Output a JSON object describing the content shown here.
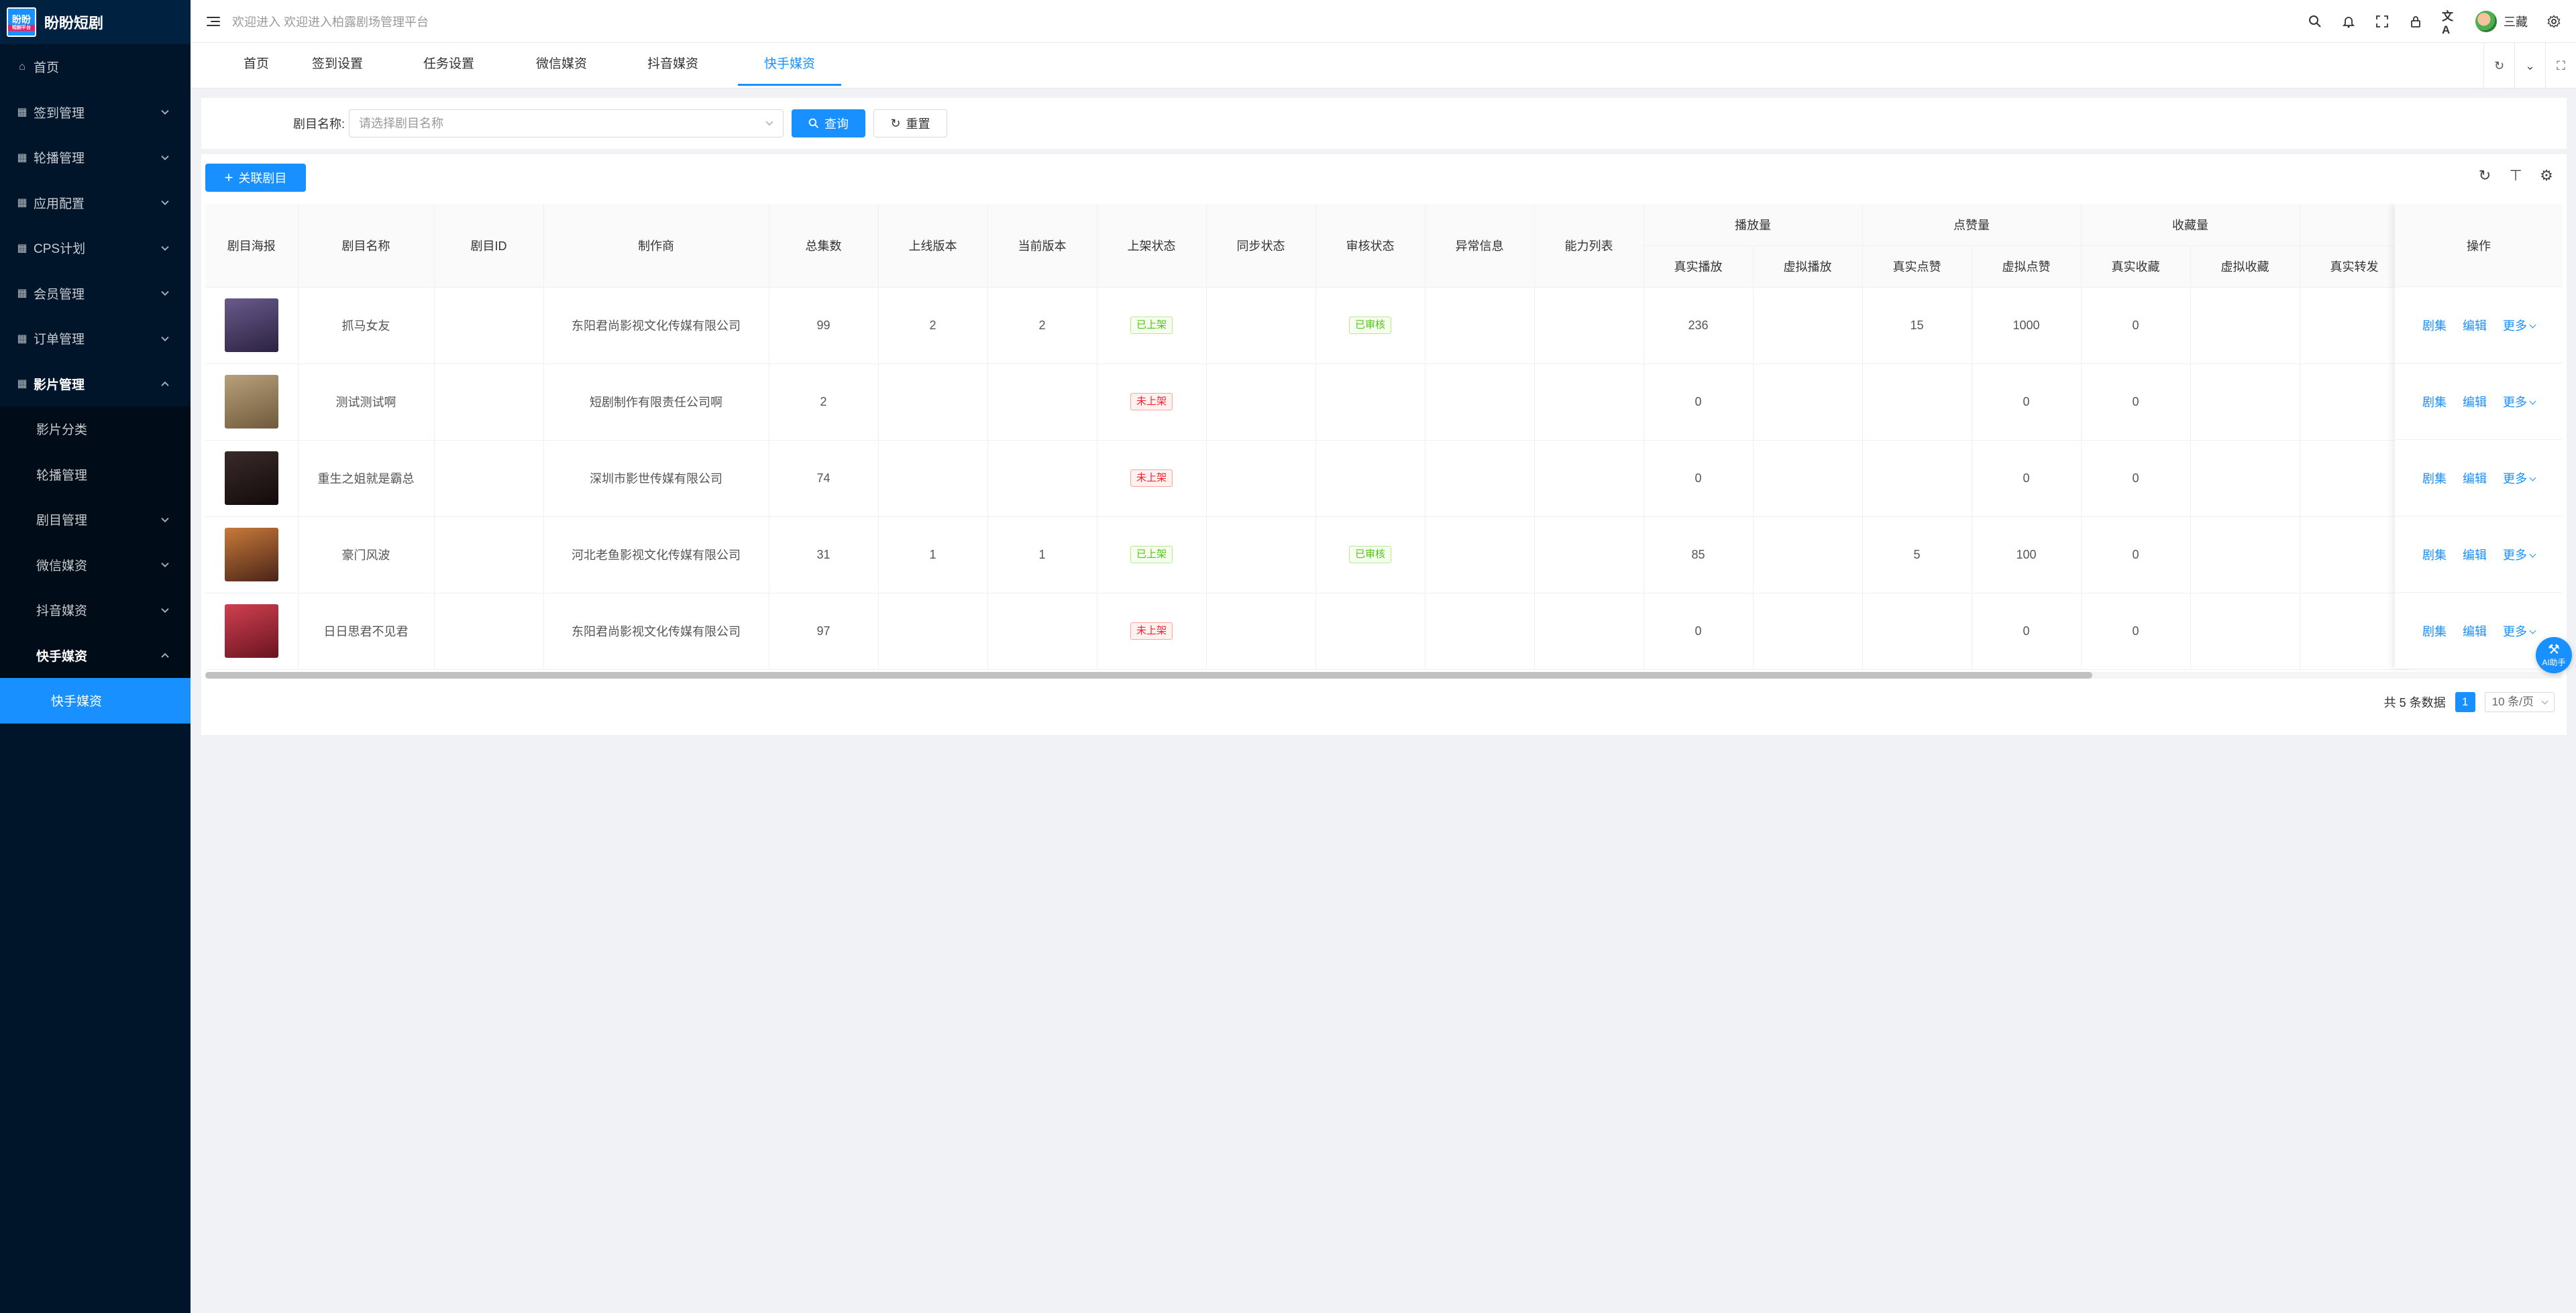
{
  "app": {
    "logo_text": "盼盼",
    "logo_sub": "短剧平台",
    "title": "盼盼短剧"
  },
  "sidebar": {
    "items": [
      {
        "label": "首页",
        "icon": "home-icon"
      },
      {
        "label": "签到管理",
        "icon": "grid-icon"
      },
      {
        "label": "轮播管理",
        "icon": "grid-icon"
      },
      {
        "label": "应用配置",
        "icon": "grid-icon"
      },
      {
        "label": "CPS计划",
        "icon": "grid-icon"
      },
      {
        "label": "会员管理",
        "icon": "grid-icon"
      },
      {
        "label": "订单管理",
        "icon": "grid-icon"
      },
      {
        "label": "影片管理",
        "icon": "grid-icon"
      }
    ],
    "film_sub": [
      "影片分类",
      "轮播管理",
      "剧目管理",
      "微信媒资",
      "抖音媒资",
      "快手媒资"
    ],
    "kuaishou_sub": [
      "快手媒资"
    ]
  },
  "header": {
    "welcome": "欢迎进入 欢迎进入柏露剧场管理平台",
    "username": "三藏"
  },
  "tabs": [
    "首页",
    "签到设置",
    "任务设置",
    "微信媒资",
    "抖音媒资",
    "快手媒资"
  ],
  "search": {
    "label": "剧目名称:",
    "placeholder": "请选择剧目名称",
    "query_label": "查询",
    "reset_label": "重置"
  },
  "toolbar": {
    "add_label": "关联剧目"
  },
  "table": {
    "headers": [
      "剧目海报",
      "剧目名称",
      "剧目ID",
      "制作商",
      "总集数",
      "上线版本",
      "当前版本",
      "上架状态",
      "同步状态",
      "审核状态",
      "异常信息",
      "能力列表"
    ],
    "group_headers": [
      "播放量",
      "点赞量",
      "收藏量"
    ],
    "sub_headers": [
      "真实播放",
      "虚拟播放",
      "真实点赞",
      "虚拟点赞",
      "真实收藏",
      "虚拟收藏",
      "真实转发"
    ],
    "op_header": "操作",
    "rows": [
      {
        "name": "抓马女友",
        "id": "",
        "producer": "东阳君尚影视文化传媒有限公司",
        "episodes": "99",
        "online_ver": "2",
        "cur_ver": "2",
        "shelf": "已上架",
        "shelf_type": "green",
        "sync": "",
        "review": "已审核",
        "error": "",
        "ability": "",
        "real_play": "236",
        "virt_play": "",
        "real_like": "15",
        "virt_like": "1000",
        "real_fav": "0",
        "virt_fav": "",
        "real_share": "",
        "poster": [
          "#6a5a8c",
          "#2b2240"
        ]
      },
      {
        "name": "测试测试啊",
        "id": "",
        "producer": "短剧制作有限责任公司啊",
        "episodes": "2",
        "online_ver": "",
        "cur_ver": "",
        "shelf": "未上架",
        "shelf_type": "red",
        "sync": "",
        "review": "",
        "error": "",
        "ability": "",
        "real_play": "0",
        "virt_play": "",
        "real_like": "",
        "virt_like": "0",
        "real_fav": "0",
        "virt_fav": "",
        "real_share": "",
        "poster": [
          "#b8a07a",
          "#6f5a3c"
        ]
      },
      {
        "name": "重生之姐就是霸总",
        "id": "",
        "producer": "深圳市影世传媒有限公司",
        "episodes": "74",
        "online_ver": "",
        "cur_ver": "",
        "shelf": "未上架",
        "shelf_type": "red",
        "sync": "",
        "review": "",
        "error": "",
        "ability": "",
        "real_play": "0",
        "virt_play": "",
        "real_like": "",
        "virt_like": "0",
        "real_fav": "0",
        "virt_fav": "",
        "real_share": "",
        "poster": [
          "#3a2a2a",
          "#120b0b"
        ]
      },
      {
        "name": "豪门风波",
        "id": "",
        "producer": "河北老鱼影视文化传媒有限公司",
        "episodes": "31",
        "online_ver": "1",
        "cur_ver": "1",
        "shelf": "已上架",
        "shelf_type": "green",
        "sync": "",
        "review": "已审核",
        "error": "",
        "ability": "",
        "real_play": "85",
        "virt_play": "",
        "real_like": "5",
        "virt_like": "100",
        "real_fav": "0",
        "virt_fav": "",
        "real_share": "",
        "poster": [
          "#c87a3a",
          "#4a2418"
        ]
      },
      {
        "name": "日日思君不见君",
        "id": "",
        "producer": "东阳君尚影视文化传媒有限公司",
        "episodes": "97",
        "online_ver": "",
        "cur_ver": "",
        "shelf": "未上架",
        "shelf_type": "red",
        "sync": "",
        "review": "",
        "error": "",
        "ability": "",
        "real_play": "0",
        "virt_play": "",
        "real_like": "",
        "virt_like": "0",
        "real_fav": "0",
        "virt_fav": "",
        "real_share": "",
        "poster": [
          "#d04050",
          "#6a1420"
        ]
      }
    ],
    "ops": [
      "剧集",
      "编辑",
      "更多"
    ]
  },
  "pagination": {
    "total": "共 5 条数据",
    "page": "1",
    "page_size": "10 条/页"
  },
  "ai_button": {
    "label": "AI助手"
  },
  "colors": {
    "primary": "#1890ff",
    "sidebar_bg": "#001529",
    "success": "#52c41a",
    "danger": "#f5222d"
  }
}
